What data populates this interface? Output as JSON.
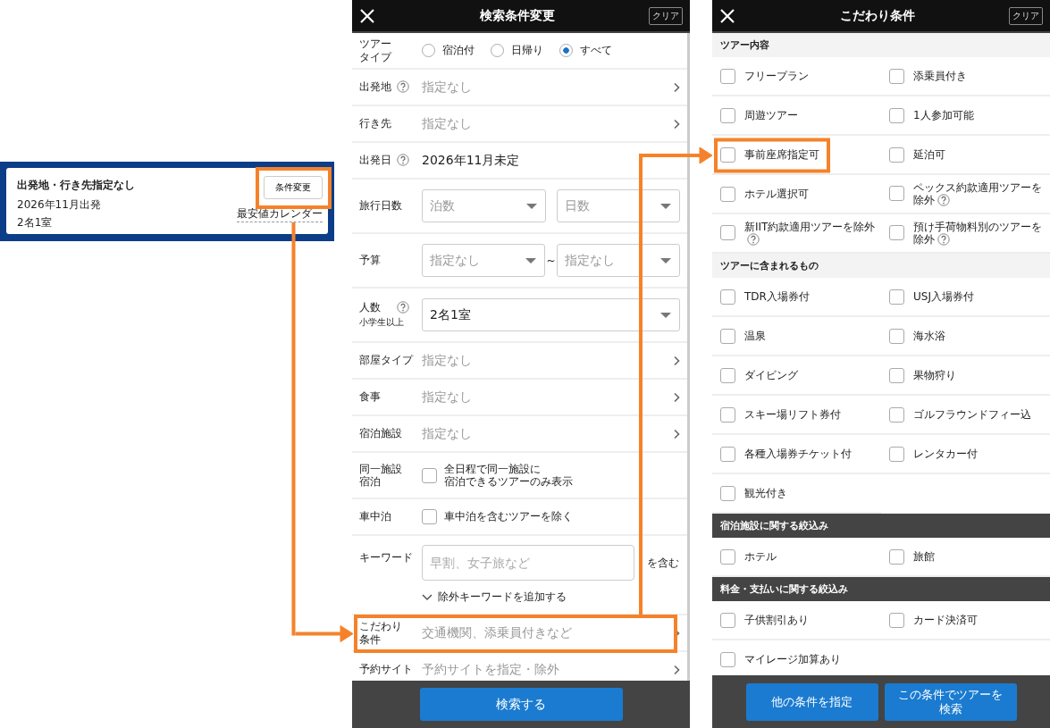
{
  "summary_card": {
    "title": "出発地・行き先指定なし",
    "date": "2026年11月出発",
    "party": "2名1室",
    "change_button": {
      "label": "条件変更",
      "highlighted": true
    },
    "calendar_link": "最安値カレンダー"
  },
  "search_panel": {
    "title": "検索条件変更",
    "clear_button": "クリア",
    "rows": [
      {
        "kind": "radio",
        "label": [
          "ツアー",
          "タイプ"
        ],
        "highlighted": false,
        "options": [
          {
            "label": "宿泊付",
            "selected": false
          },
          {
            "label": "日帰り",
            "selected": false
          },
          {
            "label": "すべて",
            "selected": true
          }
        ]
      },
      {
        "kind": "link",
        "label": "出発地",
        "help": true,
        "value": "指定なし",
        "highlighted": false
      },
      {
        "kind": "link",
        "label": "行き先",
        "help": false,
        "value": "指定なし",
        "highlighted": false
      },
      {
        "kind": "date",
        "label": "出発日",
        "help": true,
        "value": "2026年11月未定",
        "highlighted": false
      },
      {
        "kind": "selects",
        "label": "旅行日数",
        "highlighted": false,
        "selects": [
          {
            "placeholder": "泊数"
          },
          {
            "placeholder": "日数"
          }
        ]
      },
      {
        "kind": "selects",
        "label": "予算",
        "separator": "~",
        "highlighted": false,
        "selects": [
          {
            "placeholder": "指定なし"
          },
          {
            "placeholder": "指定なし"
          }
        ]
      },
      {
        "kind": "people",
        "label": "人数",
        "sublabel": "小学生以上",
        "help": true,
        "value": "2名1室",
        "highlighted": false
      },
      {
        "kind": "link",
        "label": "部屋タイプ",
        "help": false,
        "value": "指定なし",
        "highlighted": false
      },
      {
        "kind": "link",
        "label": "食事",
        "help": false,
        "value": "指定なし",
        "highlighted": false
      },
      {
        "kind": "link",
        "label": "宿泊施設",
        "help": false,
        "value": "指定なし",
        "highlighted": false
      },
      {
        "kind": "checkbox",
        "label": [
          "同一施設",
          "宿泊"
        ],
        "text": [
          "全日程で同一施設に",
          "宿泊できるツアーのみ表示"
        ],
        "checked": false,
        "highlighted": false
      },
      {
        "kind": "checkbox",
        "label": "車中泊",
        "text": "車中泊を含むツアーを除く",
        "checked": false,
        "highlighted": false
      },
      {
        "kind": "keyword",
        "label": "キーワード",
        "placeholder": "早割、女子旅など",
        "suffix": "を含む",
        "toggle_link": "除外キーワードを追加する",
        "highlighted": false
      },
      {
        "kind": "link",
        "label": [
          "こだわり",
          "条件"
        ],
        "help": false,
        "value": "交通機関、添乗員付きなど",
        "highlighted": true
      },
      {
        "kind": "link",
        "label": "予約サイト",
        "help": false,
        "value": "予約サイトを指定・除外",
        "highlighted": false
      }
    ],
    "search_button": "検索する"
  },
  "preference_panel": {
    "title": "こだわり条件",
    "clear_button": "クリア",
    "sections": [
      {
        "kind": "light",
        "title": "ツアー内容",
        "items": [
          {
            "label": "フリープラン",
            "help": false,
            "checked": false,
            "highlighted": false
          },
          {
            "label": "添乗員付き",
            "help": false,
            "checked": false,
            "highlighted": false
          },
          {
            "label": "周遊ツアー",
            "help": false,
            "checked": false,
            "highlighted": false
          },
          {
            "label": "1人参加可能",
            "help": false,
            "checked": false,
            "highlighted": false
          },
          {
            "label": "事前座席指定可",
            "help": false,
            "checked": false,
            "highlighted": true
          },
          {
            "label": "延泊可",
            "help": false,
            "checked": false,
            "highlighted": false
          },
          {
            "label": "ホテル選択可",
            "help": false,
            "checked": false,
            "highlighted": false
          },
          {
            "label": "ペックス約款適用ツアーを除外",
            "help": true,
            "checked": false,
            "highlighted": false
          },
          {
            "label": "新IIT約款適用ツアーを除外",
            "help": true,
            "checked": false,
            "highlighted": false
          },
          {
            "label": "預け手荷物料別のツアーを除外",
            "help": true,
            "checked": false,
            "highlighted": false
          }
        ]
      },
      {
        "kind": "light",
        "title": "ツアーに含まれるもの",
        "items": [
          {
            "label": "TDR入場券付",
            "help": false,
            "checked": false,
            "highlighted": false
          },
          {
            "label": "USJ入場券付",
            "help": false,
            "checked": false,
            "highlighted": false
          },
          {
            "label": "温泉",
            "help": false,
            "checked": false,
            "highlighted": false
          },
          {
            "label": "海水浴",
            "help": false,
            "checked": false,
            "highlighted": false
          },
          {
            "label": "ダイビング",
            "help": false,
            "checked": false,
            "highlighted": false
          },
          {
            "label": "果物狩り",
            "help": false,
            "checked": false,
            "highlighted": false
          },
          {
            "label": "スキー場リフト券付",
            "help": false,
            "checked": false,
            "highlighted": false
          },
          {
            "label": "ゴルフラウンドフィー込",
            "help": false,
            "checked": false,
            "highlighted": false
          },
          {
            "label": "各種入場券チケット付",
            "help": false,
            "checked": false,
            "highlighted": false
          },
          {
            "label": "レンタカー付",
            "help": false,
            "checked": false,
            "highlighted": false
          },
          {
            "label": "観光付き",
            "help": false,
            "checked": false,
            "highlighted": false
          }
        ]
      },
      {
        "kind": "dark",
        "title": "宿泊施設に関する絞込み",
        "items": [
          {
            "label": "ホテル",
            "help": false,
            "checked": false,
            "highlighted": false
          },
          {
            "label": "旅館",
            "help": false,
            "checked": false,
            "highlighted": false
          }
        ]
      },
      {
        "kind": "dark",
        "title": "料金・支払いに関する絞込み",
        "items": [
          {
            "label": "子供割引あり",
            "help": false,
            "checked": false,
            "highlighted": false
          },
          {
            "label": "カード決済可",
            "help": false,
            "checked": false,
            "highlighted": false
          },
          {
            "label": "マイレージ加算あり",
            "help": false,
            "checked": false,
            "highlighted": false
          }
        ]
      }
    ],
    "buttons": [
      "他の条件を指定",
      "この条件でツアーを検索"
    ]
  }
}
